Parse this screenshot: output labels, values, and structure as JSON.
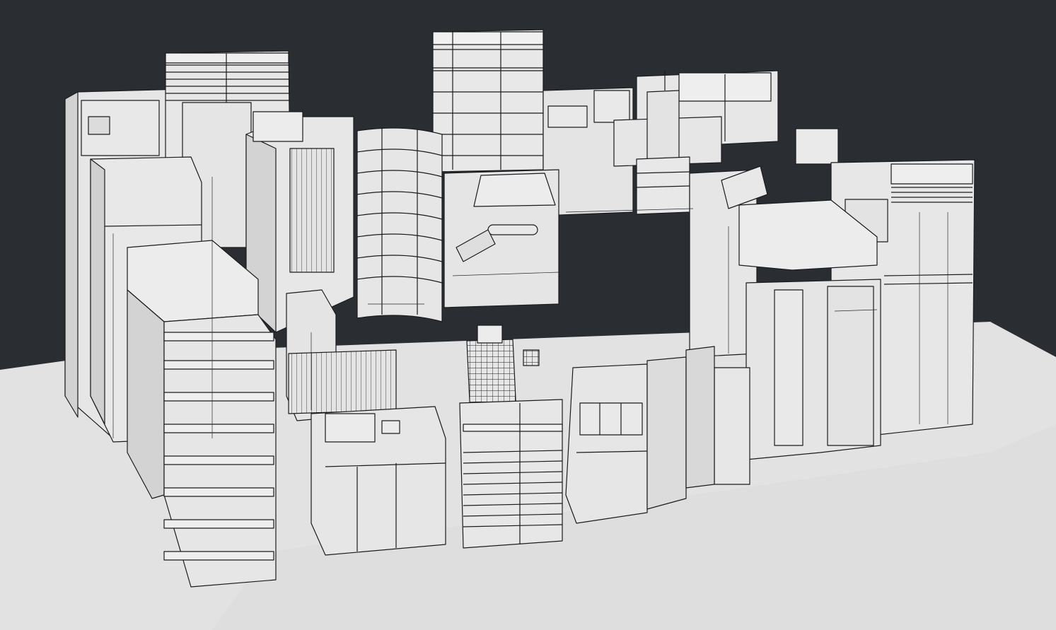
{
  "viewport": {
    "background_color": "#2a2e33",
    "ground_color": "#e2e2e2",
    "building_color": "#e6e6e6",
    "shade_color": "#cfcfcf",
    "wire_color": "#1a1c1f"
  }
}
